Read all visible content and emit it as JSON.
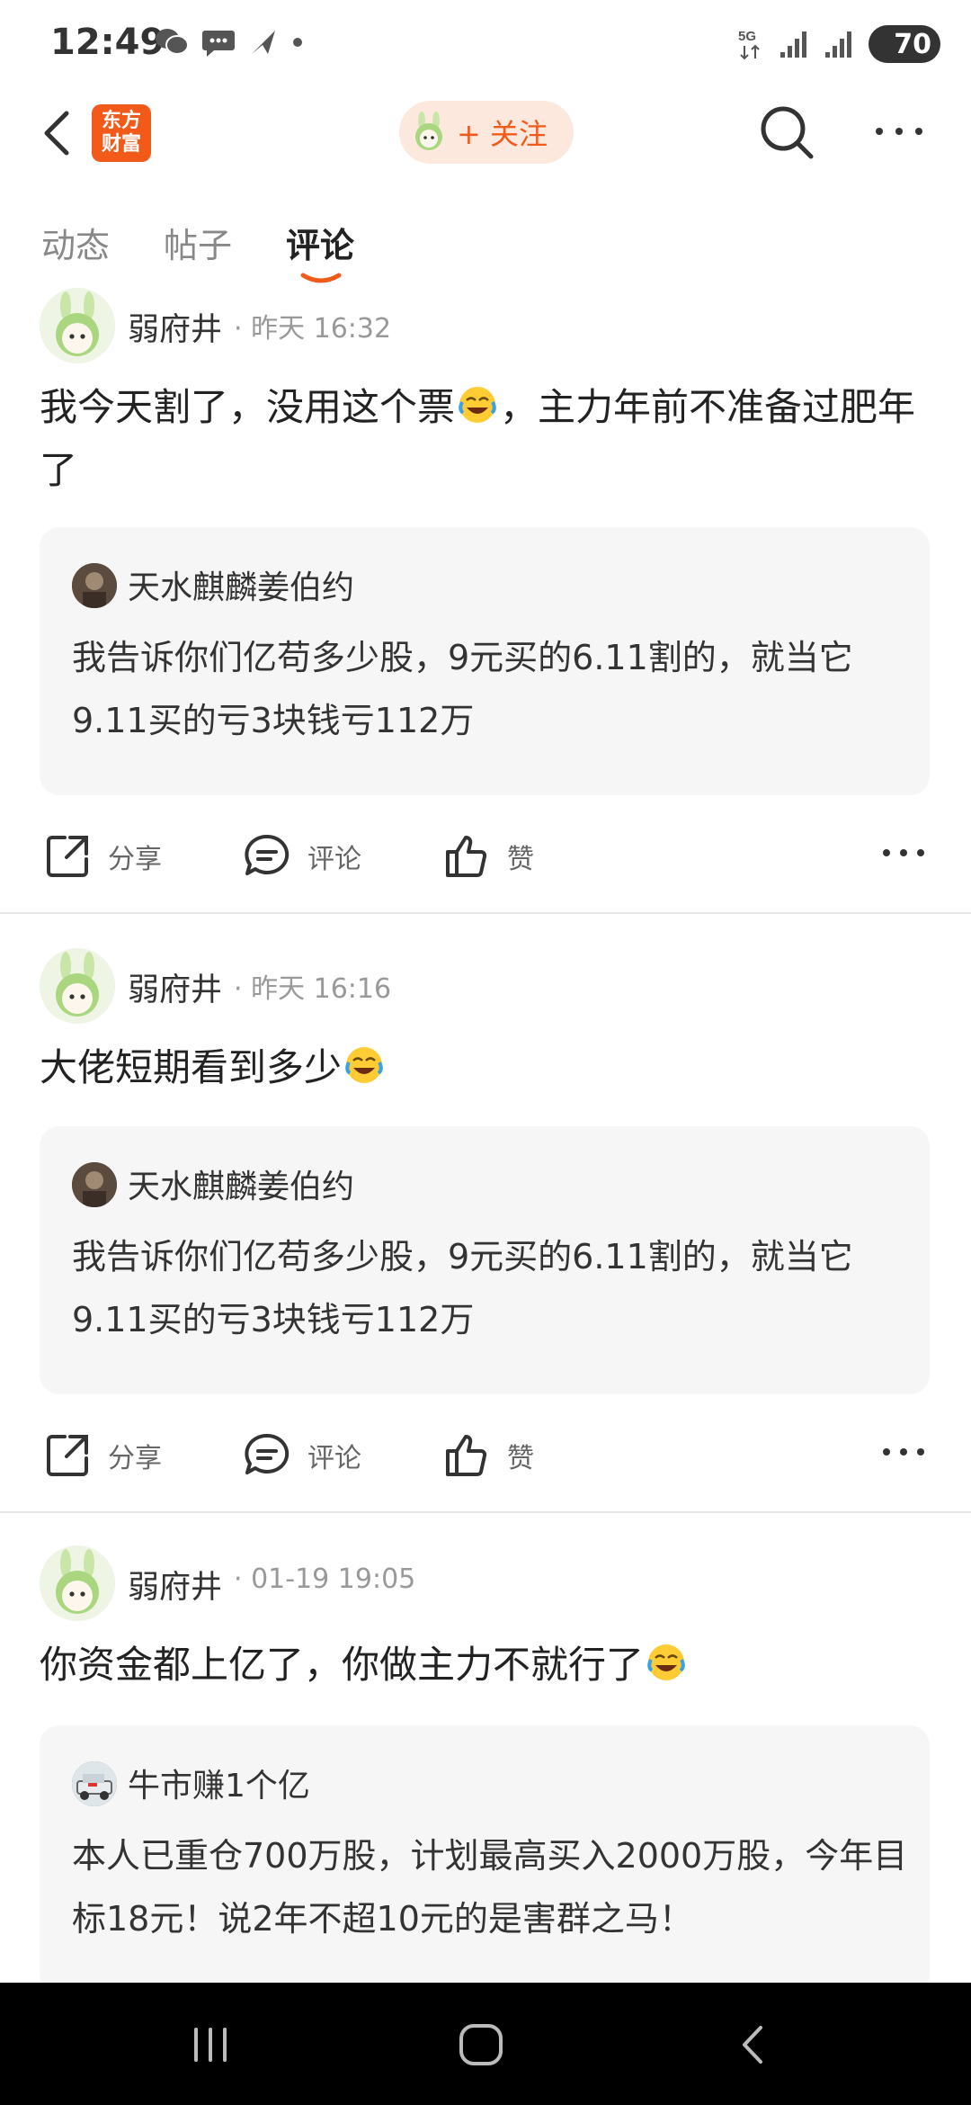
{
  "status_bar": {
    "time": "12:49",
    "network": "5G",
    "battery": "70",
    "left_icons": [
      "wechat-icon",
      "message-icon",
      "send-icon",
      "dot-icon"
    ],
    "right_icons": [
      "5g-icon",
      "signal-icon",
      "signal-icon",
      "battery-icon"
    ]
  },
  "nav": {
    "logo_text_line1": "东方",
    "logo_text_line2": "财富",
    "follow_label": "+ 关注",
    "brand_color": "#f25a1a"
  },
  "tabs": [
    {
      "label": "动态",
      "active": false
    },
    {
      "label": "帖子",
      "active": false
    },
    {
      "label": "评论",
      "active": true
    }
  ],
  "posts": [
    {
      "author": "弱府井",
      "time": "· 昨天 16:32",
      "content_before_emoji": "我今天割了，没用这个票",
      "content_after_emoji": "，主力年前不准备过肥年了",
      "quote": {
        "author": "天水麒麟姜伯约",
        "text": "我告诉你们亿苟多少股，9元买的6.11割的，就当它9.11买的亏3块钱亏112万"
      },
      "actions": {
        "share": "分享",
        "comment": "评论",
        "like": "赞"
      }
    },
    {
      "author": "弱府井",
      "time": "· 昨天 16:16",
      "content_before_emoji": "大佬短期看到多少",
      "content_after_emoji": "",
      "quote": {
        "author": "天水麒麟姜伯约",
        "text": "我告诉你们亿苟多少股，9元买的6.11割的，就当它9.11买的亏3块钱亏112万"
      },
      "actions": {
        "share": "分享",
        "comment": "评论",
        "like": "赞"
      }
    },
    {
      "author": "弱府井",
      "time": "· 01-19 19:05",
      "content_before_emoji": "你资金都上亿了，你做主力不就行了",
      "content_after_emoji": "",
      "quote": {
        "author": "牛市赚1个亿",
        "text": "本人已重仓700万股，计划最高买入2000万股，今年目标18元！说2年不超10元的是害群之马！"
      }
    }
  ]
}
